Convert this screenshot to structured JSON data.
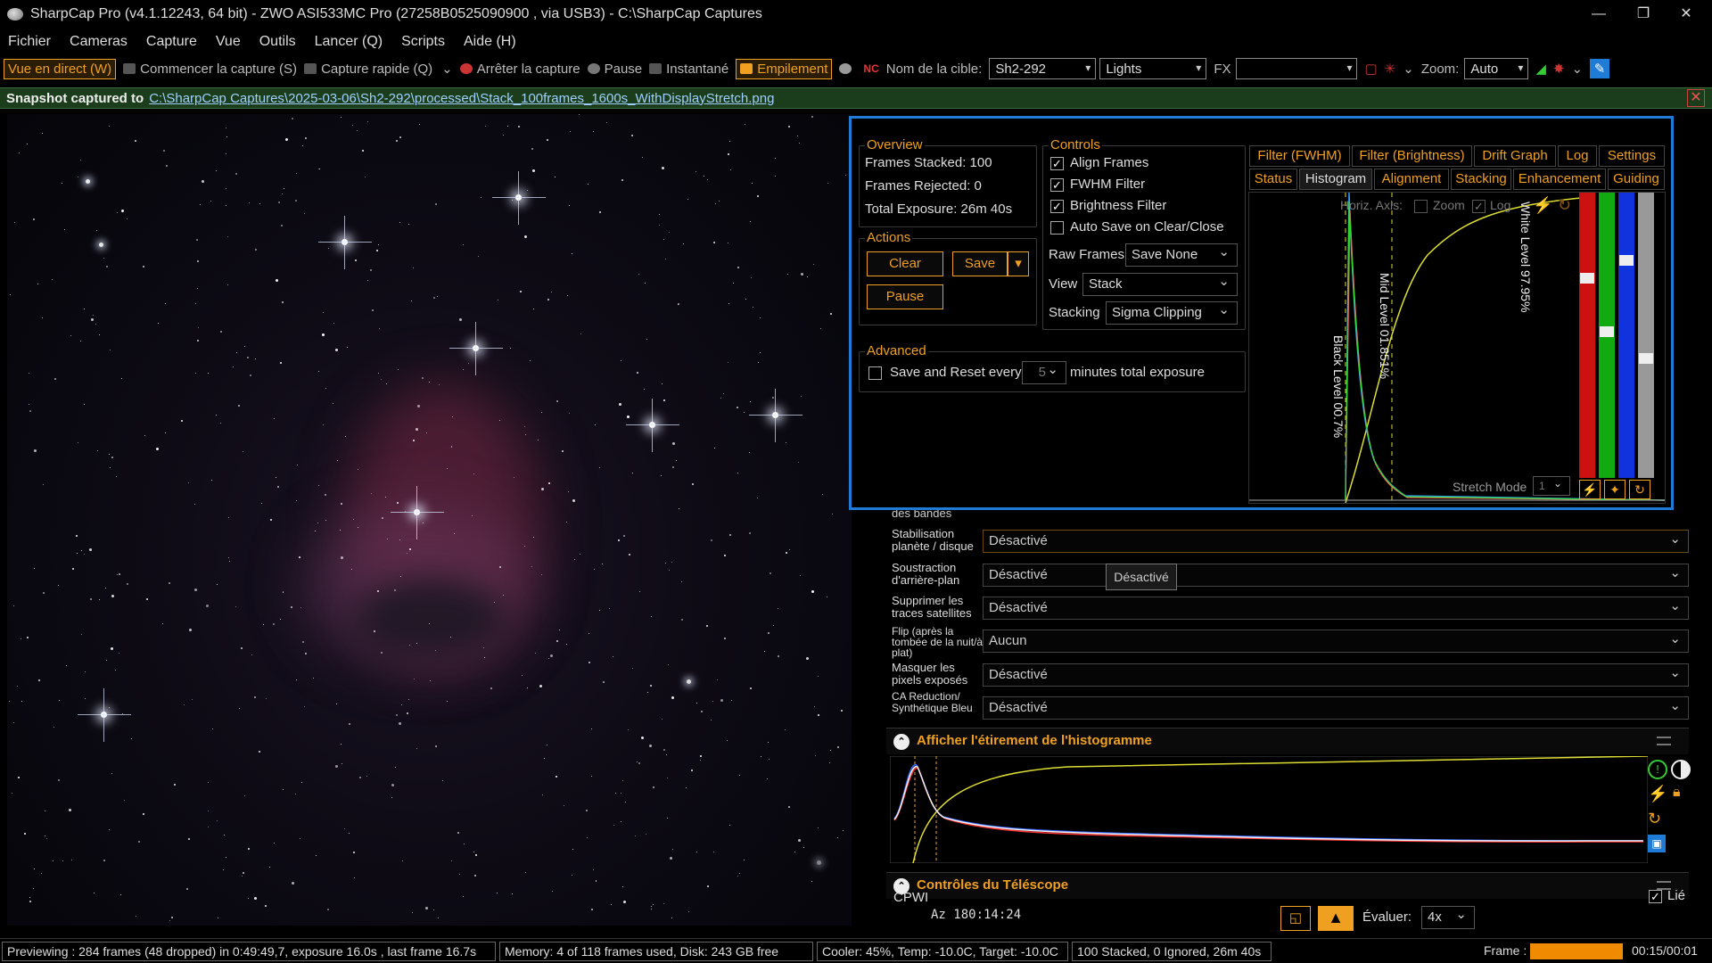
{
  "titlebar": {
    "title": "SharpCap Pro (v4.1.12243, 64 bit) - ZWO ASI533MC Pro (27258B0525090900 , via USB3) - C:\\SharpCap Captures",
    "minimize": "—",
    "restore": "❐",
    "close": "✕"
  },
  "menu": [
    "Fichier",
    "Cameras",
    "Capture",
    "Vue",
    "Outils",
    "Lancer (Q)",
    "Scripts",
    "Aide (H)"
  ],
  "toolbar": {
    "live": "Vue en direct (W)",
    "start": "Commencer la capture (S)",
    "quick": "Capture rapide (Q)",
    "stop": "Arrêter la capture",
    "pause": "Pause",
    "snapshot": "Instantané",
    "stack": "Empilement",
    "target_label": "Nom de la cible:",
    "target": "Sh2-292",
    "frame_type": "Lights",
    "fx_label": "FX",
    "fx_value": "",
    "zoom_label": "Zoom:",
    "zoom_value": "Auto"
  },
  "notice": {
    "prefix": "Snapshot captured to",
    "path": "C:\\SharpCap Captures\\2025-03-06\\Sh2-292\\processed\\Stack_100frames_1600s_WithDisplayStretch.png"
  },
  "stack_dialog": {
    "overview": {
      "title": "Overview",
      "frames_stacked": "Frames Stacked:  100",
      "frames_rejected": "Frames Rejected: 0",
      "total_exposure": "Total Exposure:    26m 40s"
    },
    "actions": {
      "title": "Actions",
      "clear": "Clear",
      "save": "Save",
      "pause": "Pause"
    },
    "controls": {
      "title": "Controls",
      "align": "Align Frames",
      "fwhm": "FWHM Filter",
      "brightness": "Brightness Filter",
      "autosave": "Auto Save on Clear/Close",
      "raw_label": "Raw Frames",
      "raw_value": "Save None",
      "view_label": "View",
      "view_value": "Stack",
      "stacking_label": "Stacking",
      "stacking_value": "Sigma Clipping"
    },
    "advanced": {
      "title": "Advanced",
      "save_reset": "Save and Reset every",
      "minutes": "5",
      "suffix": "minutes total exposure"
    },
    "tabs_top": [
      "Filter (FWHM)",
      "Filter (Brightness)",
      "Drift Graph",
      "Log",
      "Settings"
    ],
    "tabs_bottom": [
      "Status",
      "Histogram",
      "Alignment",
      "Stacking",
      "Enhancement",
      "Guiding"
    ],
    "histogram": {
      "horiz_axis": "Horiz. Axis:",
      "zoom": "Zoom",
      "log": "Log",
      "black_level": "Black Level 00.7%",
      "mid_level": "Mid Level 01.851%",
      "white_level": "White Level 97.95%",
      "stretch_mode": "Stretch Mode",
      "stretch_value": "1"
    }
  },
  "processing": {
    "cut_label": "des bandes",
    "rows": [
      {
        "label": "Stabilisation planète / disque",
        "value": "Désactivé"
      },
      {
        "label": "Soustraction d'arrière-plan",
        "value": "Désactivé"
      },
      {
        "label": "Supprimer les traces satellites",
        "value": "Désactivé"
      },
      {
        "label": "Flip (après la tombée de la nuit/à plat)",
        "value": "Aucun"
      },
      {
        "label": "Masquer les pixels exposés",
        "value": "Désactivé"
      },
      {
        "label": "CA Reduction/ Synthétique Bleu",
        "value": "Désactivé"
      }
    ],
    "tooltip": "Désactivé"
  },
  "sections": {
    "histogram_stretch": "Afficher l'étirement de l'histogramme",
    "telescope": "Contrôles du Téléscope"
  },
  "telescope": {
    "name": "CPWI",
    "az": "Az   180:14:24",
    "rate_label": "Évaluer:",
    "rate_value": "4x",
    "link_label": "Lié"
  },
  "statusbar": {
    "preview": "Previewing : 284 frames (48 dropped) in 0:49:49,7, exposure 16.0s , last frame 16.7s",
    "memory": "Memory: 4 of 118 frames used, Disk: 243 GB free",
    "cooler": "Cooler: 45%, Temp: -10.0C, Target: -10.0C",
    "stack": "100 Stacked, 0 Ignored, 26m 40s",
    "frame_label": "Frame :",
    "frame_progress": 1.0,
    "time": "00:15/00:01"
  },
  "colors": {
    "accent": "#f0a020",
    "dialog_border": "#1e7bd6",
    "notice_bg": "#1b3d1b"
  }
}
